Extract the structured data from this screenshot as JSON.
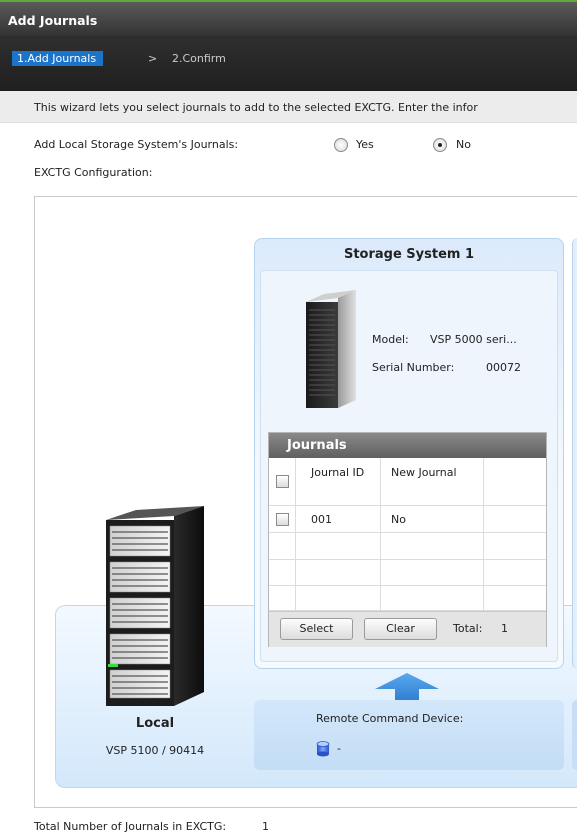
{
  "title": "Add Journals",
  "steps": {
    "active": "1.Add Journals",
    "separator": ">",
    "next": "2.Confirm"
  },
  "description": "This wizard lets you select journals to add to the selected EXCTG. Enter the infor",
  "add_local": {
    "label": "Add Local Storage System's Journals:",
    "options": [
      "Yes",
      "No"
    ],
    "selected": "No"
  },
  "config_label": "EXCTG Configuration:",
  "storage_system": {
    "title": "Storage System 1",
    "model_label": "Model:",
    "model_value": "VSP 5000 seri...",
    "serial_label": "Serial Number:",
    "serial_value": "00072"
  },
  "journals_table": {
    "title": "Journals",
    "columns": [
      "Journal ID",
      "New Journal"
    ],
    "rows": [
      {
        "journal_id": "001",
        "new_journal": "No"
      }
    ],
    "buttons": {
      "select": "Select",
      "clear": "Clear"
    },
    "total_label": "Total:",
    "total_value": "1"
  },
  "remote_command_device": {
    "label": "Remote Command Device:",
    "value": "-"
  },
  "local": {
    "name": "Local",
    "model": "VSP 5100 / 90414"
  },
  "footer": {
    "label": "Total Number of Journals in EXCTG:",
    "value": "1"
  },
  "icons": {
    "storage": "server-tower-icon",
    "local": "storage-rack-icon",
    "device": "database-icon",
    "arrow": "arrow-up-icon"
  },
  "colors": {
    "accent": "#1b74c9",
    "title_border": "#5fa83a",
    "panel": "#dbeafb"
  }
}
